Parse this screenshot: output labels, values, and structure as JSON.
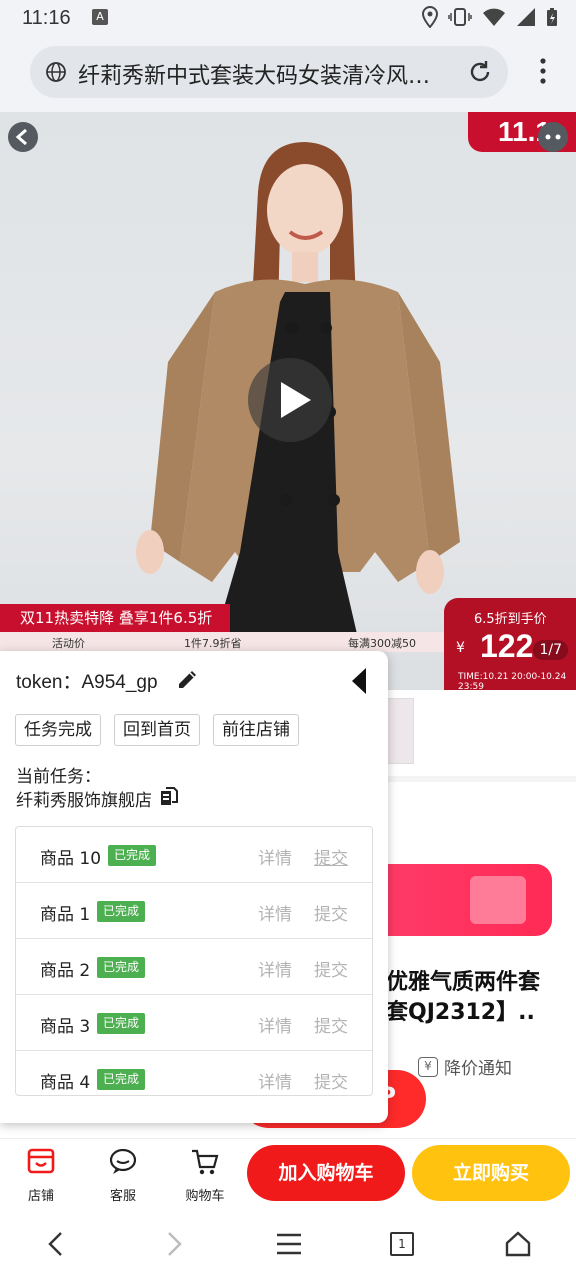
{
  "status_bar": {
    "time": "11:16",
    "notif_icon": "A"
  },
  "browser": {
    "url_title": "纤莉秀新中式套装大码女装清冷风优…"
  },
  "hero": {
    "badge": "11.1",
    "promo_title": "双11热卖特降  叠享1件6.5折",
    "promo_items": [
      "活动价",
      "1件7.9折省",
      "每满300减50"
    ],
    "price_label": "6.5折到手价",
    "currency": "¥",
    "price": "122",
    "image_counter": "1/7",
    "timer": "TIME:10.21 20:00-10.24 23:59"
  },
  "panel": {
    "token_label": "token：",
    "token_value": "A954_gp",
    "buttons": {
      "task_done": "任务完成",
      "back_home": "回到首页",
      "go_shop": "前往店铺"
    },
    "current_task_label": "当前任务：",
    "shop_name": "纤莉秀服饰旗舰店",
    "rows": [
      {
        "name": "商品 10",
        "status": "已完成",
        "detail": "详情",
        "submit": "提交"
      },
      {
        "name": "商品 1",
        "status": "已完成",
        "detail": "详情",
        "submit": "提交"
      },
      {
        "name": "商品 2",
        "status": "已完成",
        "detail": "详情",
        "submit": "提交"
      },
      {
        "name": "商品 3",
        "status": "已完成",
        "detail": "详情",
        "submit": "提交"
      },
      {
        "name": "商品 4",
        "status": "已完成",
        "detail": "详情",
        "submit": "提交"
      }
    ]
  },
  "behind": {
    "title_line1": "优雅气质两件套",
    "title_line2": "套QJ2312】..",
    "notify_icon_char": "¥",
    "notify": "降价通知",
    "pill_text": "P"
  },
  "action_bar": {
    "store": "店铺",
    "service": "客服",
    "cart": "购物车",
    "add_cart": "加入购物车",
    "buy_now": "立即购买"
  },
  "nav": {
    "tab_count": "1"
  },
  "colors": {
    "accent_red": "#f01a1a",
    "buy_yellow": "#ffc20e",
    "badge_green": "#4caf50"
  }
}
